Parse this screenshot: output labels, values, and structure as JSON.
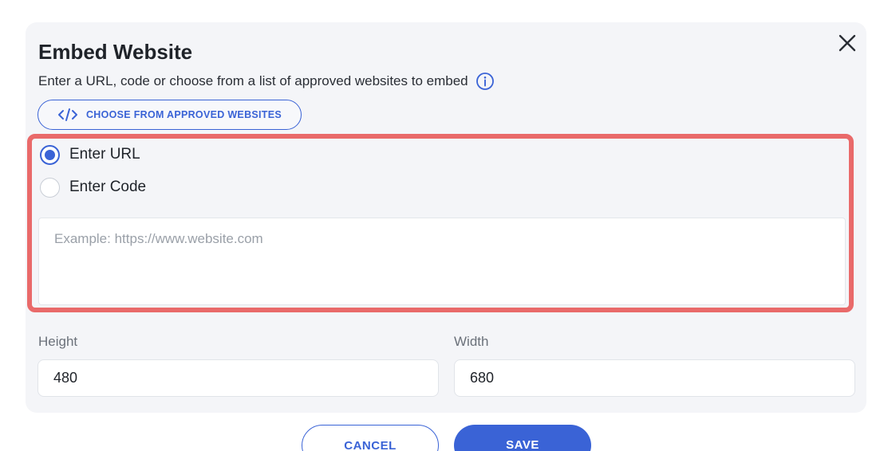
{
  "dialog": {
    "title": "Embed Website",
    "subtitle": "Enter a URL, code or choose from a list of approved websites to embed",
    "close_icon": "close-icon",
    "info_icon": "info-icon"
  },
  "choose_button": {
    "icon": "code-icon",
    "label": "CHOOSE FROM APPROVED WEBSITES"
  },
  "source_options": [
    {
      "label": "Enter URL",
      "selected": true
    },
    {
      "label": "Enter Code",
      "selected": false
    }
  ],
  "url_input": {
    "value": "",
    "placeholder": "Example: https://www.website.com"
  },
  "dimensions": {
    "height_label": "Height",
    "height_value": "480",
    "width_label": "Width",
    "width_value": "680"
  },
  "actions": {
    "cancel_label": "CANCEL",
    "save_label": "SAVE"
  },
  "colors": {
    "accent": "#3a63d6",
    "highlight": "#e96a6a",
    "dialog_bg": "#f4f5f8"
  }
}
